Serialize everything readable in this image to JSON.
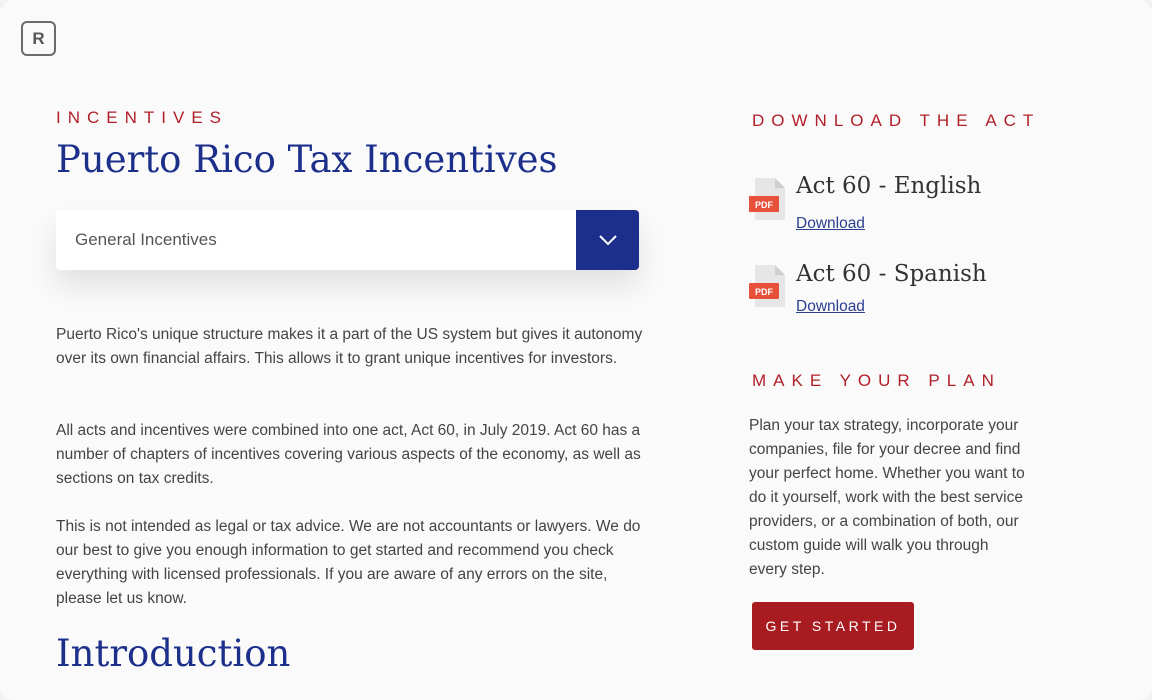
{
  "logo": {
    "letter": "R"
  },
  "main": {
    "eyebrow": "INCENTIVES",
    "title": "Puerto Rico Tax Incentives",
    "select": {
      "value": "General Incentives"
    },
    "paragraphs": [
      "Puerto Rico's unique structure makes it a part of the US system but gives it autonomy over its own financial affairs. This allows it to grant unique incentives for investors.",
      "All acts and incentives were combined into one act, Act 60, in July 2019. Act 60 has a number of chapters of incentives covering various aspects of the  economy, as well as sections on tax credits.",
      "This is not intended as legal or tax advice. We are not accountants or lawyers. We do our best to give you enough information to get started and recommend you check everything with licensed professionals. If you are aware of any errors on the site, please let us know."
    ],
    "section_heading": "Introduction"
  },
  "sidebar": {
    "download_heading": "DOWNLOAD THE ACT",
    "downloads": [
      {
        "title": "Act 60 - English",
        "link": "Download",
        "icon_label": "PDF"
      },
      {
        "title": "Act 60 - Spanish",
        "link": "Download",
        "icon_label": "PDF"
      }
    ],
    "plan_heading": "MAKE YOUR PLAN",
    "plan_text": "Plan your tax strategy, incorporate your companies, file for your decree and find your perfect home. Whether you want to do it yourself, work with the best service providers, or a combination of both, our custom guide will walk you through every step.",
    "cta_label": "GET STARTED"
  },
  "colors": {
    "accent_red": "#b1202a",
    "brand_blue": "#1c2f8a",
    "cta_red": "#a81c21"
  },
  "icons": [
    "chevron-down-icon",
    "pdf-file-icon"
  ]
}
